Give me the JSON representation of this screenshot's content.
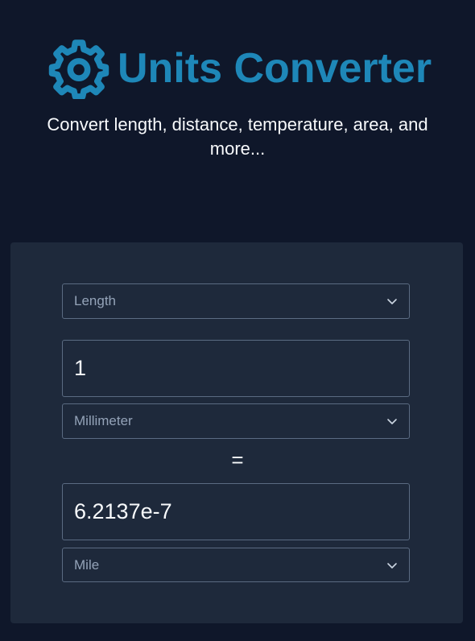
{
  "header": {
    "title": "Units Converter",
    "subtitle": "Convert length, distance, temperature, area, and more...",
    "logo_icon": "gear-icon",
    "accent_color": "#1e87b8"
  },
  "converter": {
    "category_select": {
      "value": "Length",
      "icon": "chevron-down-icon"
    },
    "from_input": {
      "value": "1"
    },
    "from_unit_select": {
      "value": "Millimeter",
      "icon": "chevron-down-icon"
    },
    "equals_sign": "=",
    "to_input": {
      "value": "6.2137e-7"
    },
    "to_unit_select": {
      "value": "Mile",
      "icon": "chevron-down-icon"
    }
  }
}
